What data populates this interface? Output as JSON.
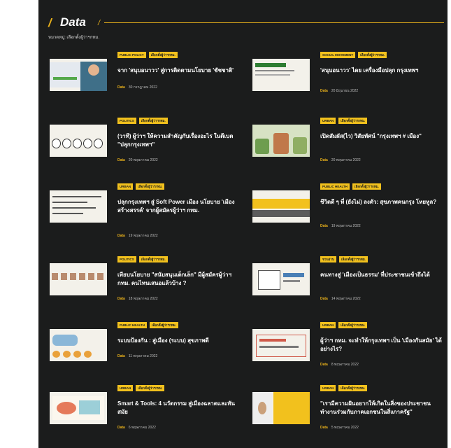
{
  "header": {
    "title": "Data",
    "subtitle": "หมวดหมู่: เลือกตั้งผู้ว่าฯกทม."
  },
  "cards": [
    {
      "tags": [
        "PUBLIC POLICY",
        "เลือกตั้งผู้ว่าฯกทม."
      ],
      "title": "จาก 'สนุบอนาวว' สู่การติดตามนโยบาย 'ชัชชาติ'",
      "author": "Data",
      "date": "30 กรกฎาคม 2022"
    },
    {
      "tags": [
        "SOCIAL MOVEMENT",
        "เลือกตั้งผู้ว่าฯกทม."
      ],
      "title": "'สนุบอนาวว' ไดย เครื่องมือปลุก กรุงเทพฯ",
      "author": "Data",
      "date": "20 มิถุนายน 2022"
    },
    {
      "tags": [
        "POLITICS",
        "เลือกตั้งผู้ว่าฯกทม."
      ],
      "title": "(วาที) ผู้ว่าฯ ให้ความสำคัญกับเรื่องอะไร ในดีเบต \"ปลุกกรุงเทพฯ\"",
      "author": "Data",
      "date": "20 พฤษภาคม 2022"
    },
    {
      "tags": [
        "URBAN",
        "เลือกตั้งผู้ว่าฯกทม."
      ],
      "title": "เปิดสัมผัส(ไว) วิสัยทัศน์ \"กรุงเทพฯ # เมือง\"",
      "author": "Data",
      "date": "20 พฤษภาคม 2022"
    },
    {
      "tags": [
        "URBAN",
        "เลือกตั้งผู้ว่าฯกทม."
      ],
      "title": "ปลุกกรุงเทพฯ สู่ Soft Power เมือง นโยบาย 'เมืองสร้างสรรค์' จากผู้สมัครผู้ว่าฯ กทม.",
      "author": "Data",
      "date": "19 พฤษภาคม 2022"
    },
    {
      "tags": [
        "PUBLIC HEALTH",
        "เลือกตั้งผู้ว่าฯกทม."
      ],
      "title": "ชีวิตดี ๆ ที่ (ยังไม่) ลงตัว: สุขภาพคนกรุง โหยหูล?",
      "author": "Data",
      "date": "19 พฤษภาคม 2022"
    },
    {
      "tags": [
        "POLITICS",
        "เลือกตั้งผู้ว่าฯกทม."
      ],
      "title": "เทียบนโยบาย \"สนับสนุนเด็กเล็ก\" มีผู้สมัครผู้ว่าฯ กทม. คนไหนเสนอแล้วบ้าง ?",
      "author": "Data",
      "date": "18 พฤษภาคม 2022"
    },
    {
      "tags": [
        "ชวนอ่าน",
        "เลือกตั้งผู้ว่าฯกทม."
      ],
      "title": "คนทางสู่ 'เมืองเป็นธรรม' ที่ประชาชนเข้าถึงได้",
      "author": "Data",
      "date": "14 พฤษภาคม 2022"
    },
    {
      "tags": [
        "PUBLIC HEALTH",
        "เลือกตั้งผู้ว่าฯกทม."
      ],
      "title": "ระบบป้องกัน : สู่เมือง (ระบบ) สุขภาพดี",
      "author": "Data",
      "date": "11 พฤษภาคม 2022"
    },
    {
      "tags": [
        "URBAN",
        "เลือกตั้งผู้ว่าฯกทม."
      ],
      "title": "ผู้ว่าฯ กทม. จะทำให้กรุงเทพฯ เป็น 'เมืองกันสมัย' ได้อย่างไร?",
      "author": "Data",
      "date": "8 พฤษภาคม 2022"
    },
    {
      "tags": [
        "URBAN",
        "เลือกตั้งผู้ว่าฯกทม."
      ],
      "title": "Smart & Tools: 4 นวัตกรรม สู่เมืองฉลาดและทันสมัย",
      "author": "Data",
      "date": "6 พฤษภาคม 2022"
    },
    {
      "tags": [
        "URBAN",
        "เลือกตั้งผู้ว่าฯกทม."
      ],
      "title": "\"เรามีความฝันอยากให้เกิดในสิ่งของประชาชน ทำงานร่วมกับภาคเอกชนในสิ่งภาครัฐ\"",
      "author": "Data",
      "date": "5 พฤษภาคม 2022"
    }
  ]
}
